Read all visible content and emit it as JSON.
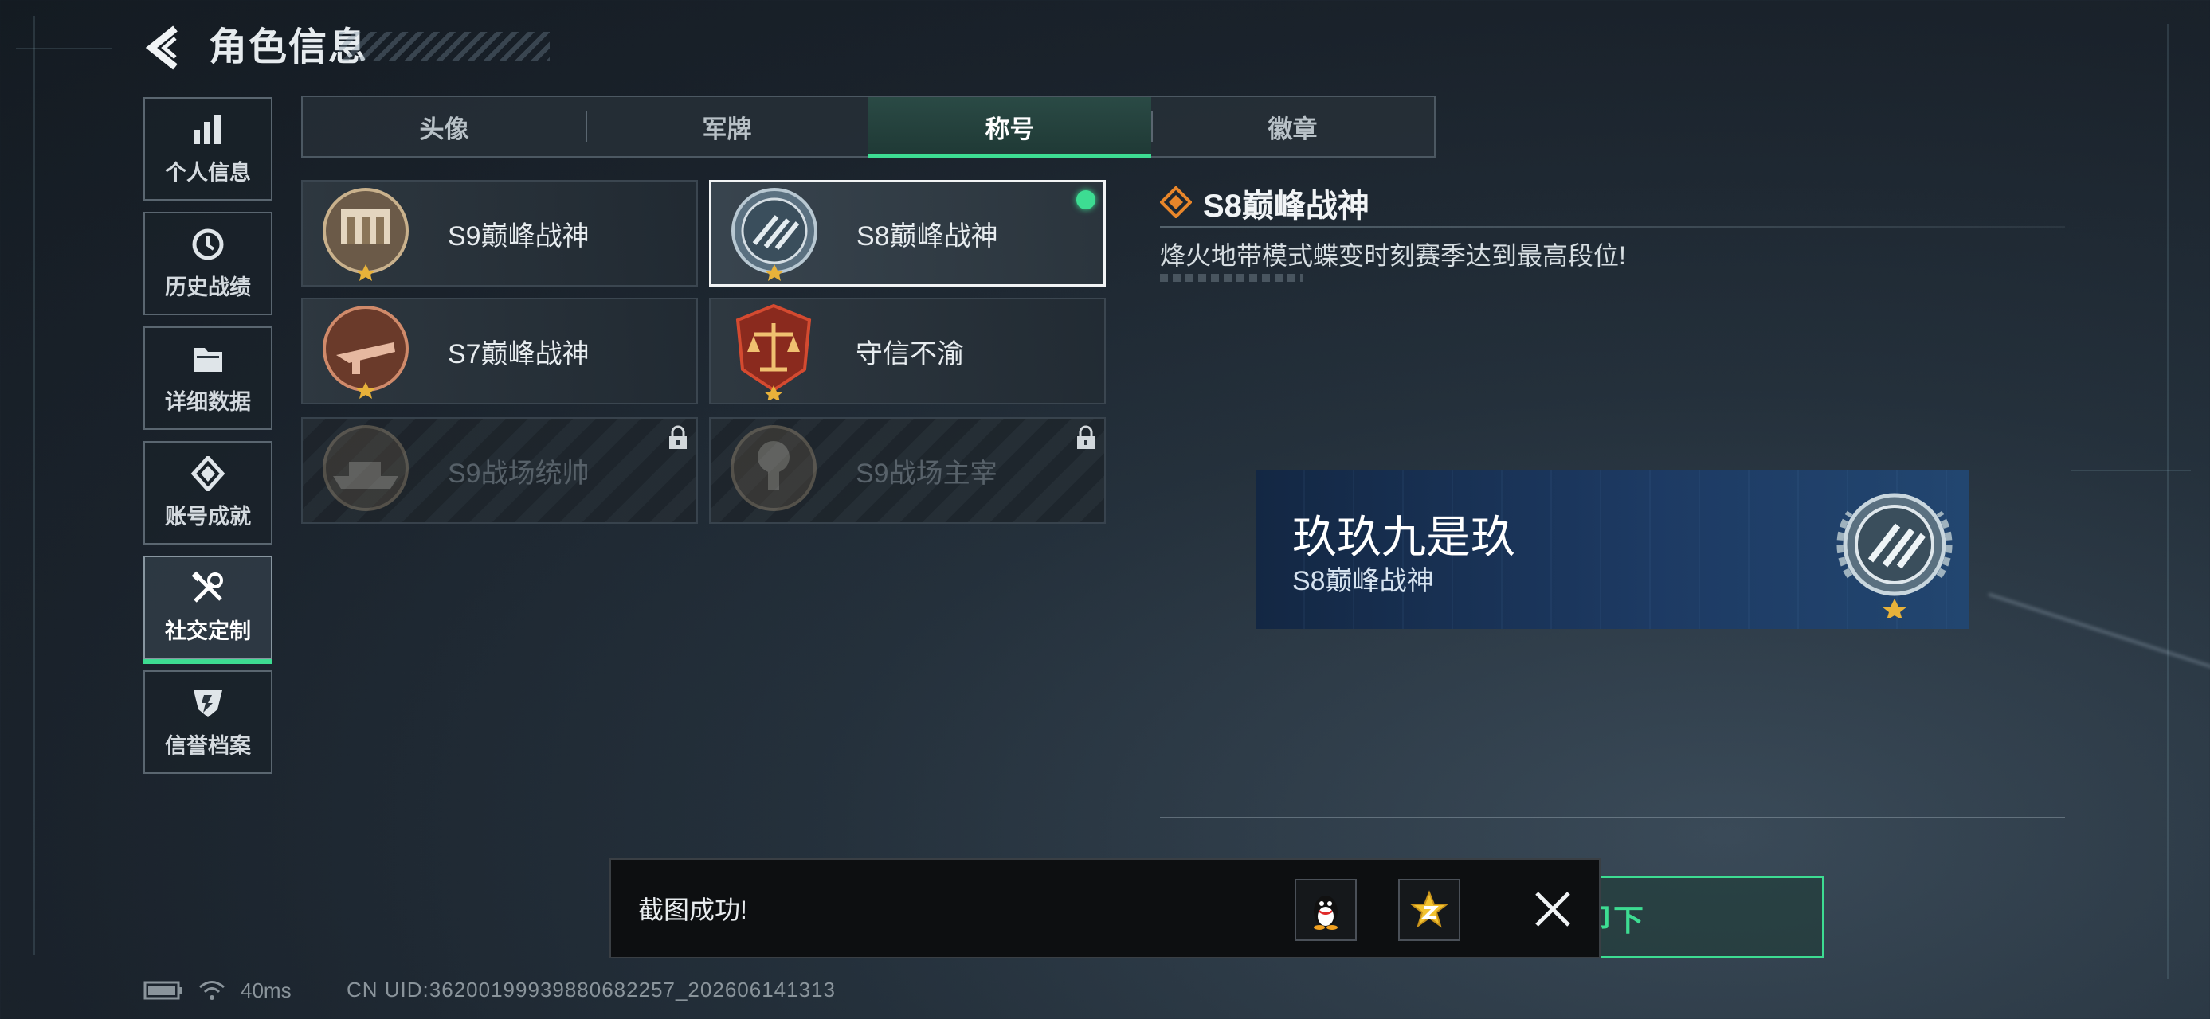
{
  "header": {
    "title": "角色信息"
  },
  "sidebar": {
    "items": [
      {
        "label": "个人信息",
        "icon": "bar-chart-icon"
      },
      {
        "label": "历史战绩",
        "icon": "history-icon"
      },
      {
        "label": "详细数据",
        "icon": "folder-icon"
      },
      {
        "label": "账号成就",
        "icon": "achievement-icon"
      },
      {
        "label": "社交定制",
        "icon": "tools-icon",
        "active": true
      },
      {
        "label": "信誉档案",
        "icon": "credit-shield-icon"
      }
    ]
  },
  "tabs": [
    "头像",
    "军牌",
    "称号",
    "徽章"
  ],
  "active_tab": "称号",
  "titles": [
    {
      "name": "S9巅峰战神",
      "locked": false,
      "selected": false
    },
    {
      "name": "S8巅峰战神",
      "locked": false,
      "selected": true
    },
    {
      "name": "S7巅峰战神",
      "locked": false,
      "selected": false
    },
    {
      "name": "守信不渝",
      "locked": false,
      "selected": false
    },
    {
      "name": "S9战场统帅",
      "locked": true,
      "selected": false
    },
    {
      "name": "S9战场主宰",
      "locked": true,
      "selected": false
    }
  ],
  "detail": {
    "title": "S8巅峰战神",
    "description": "烽火地带模式蝶变时刻赛季达到最高段位!"
  },
  "preview": {
    "player_name": "玖玖九是玖",
    "title": "S8巅峰战神"
  },
  "unequip_label": "卸下",
  "toast": {
    "message": "截图成功!"
  },
  "status": {
    "ping": "40ms",
    "uid": "CN UID:362001999398806822​57_202606141313"
  },
  "colors": {
    "accent": "#3ddc92",
    "detail_icon": "#e8862a",
    "preview_bg": "#1d3a63"
  }
}
